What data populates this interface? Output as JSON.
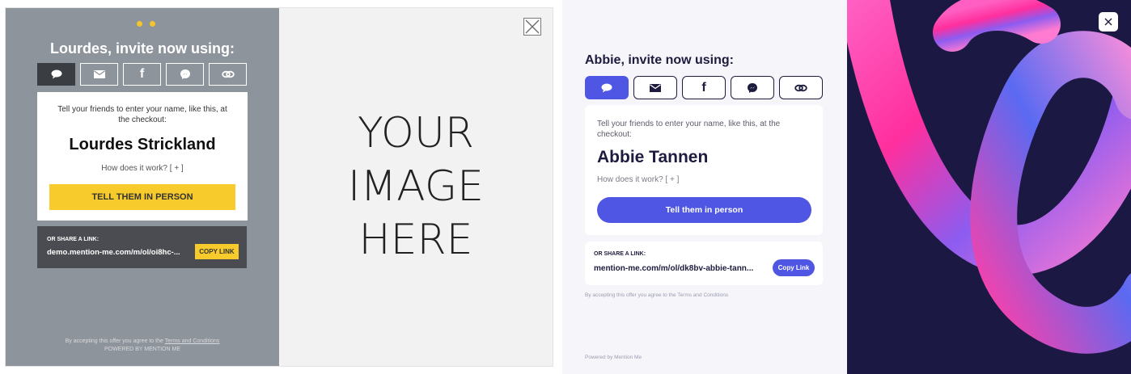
{
  "left_widget": {
    "title": "Lourdes, invite now using:",
    "share_options": [
      "sms",
      "email",
      "facebook",
      "messenger",
      "link"
    ],
    "instruction": "Tell your friends to enter your name, like this, at the checkout:",
    "referrer_name": "Lourdes Strickland",
    "how_it_works": "How does it work? [ + ]",
    "cta_label": "TELL THEM IN PERSON",
    "share_link_label": "OR SHARE A LINK:",
    "share_link_url": "demo.mention-me.com/m/ol/oi8hc-...",
    "copy_link_label": "COPY LINK",
    "terms_prefix": "By accepting this offer you agree to the ",
    "terms_link": "Terms and Conditions",
    "powered_by": "POWERED BY MENTION ME",
    "image_placeholder_line1": "YOUR",
    "image_placeholder_line2": "IMAGE",
    "image_placeholder_line3": "HERE",
    "colors": {
      "panel": "#8e949b",
      "accent": "#f7cb2b",
      "link_box": "#4a4c52"
    }
  },
  "right_widget": {
    "title": "Abbie, invite now using:",
    "share_options": [
      "sms",
      "email",
      "facebook",
      "messenger",
      "link"
    ],
    "instruction": "Tell your friends to enter your name, like this, at the checkout:",
    "referrer_name": "Abbie Tannen",
    "how_it_works": "How does it work? [ + ]",
    "cta_label": "Tell them in person",
    "share_link_label": "OR SHARE A LINK:",
    "share_link_url": "mention-me.com/m/ol/dk8bv-abbie-tann...",
    "copy_link_label": "Copy Link",
    "terms": "By accepting this offer you agree to the Terms and Conditions",
    "powered_by": "Powered by Mention Me",
    "colors": {
      "accent": "#4e56e3",
      "text": "#1d1c3f",
      "art_background": "#1c1844"
    }
  }
}
